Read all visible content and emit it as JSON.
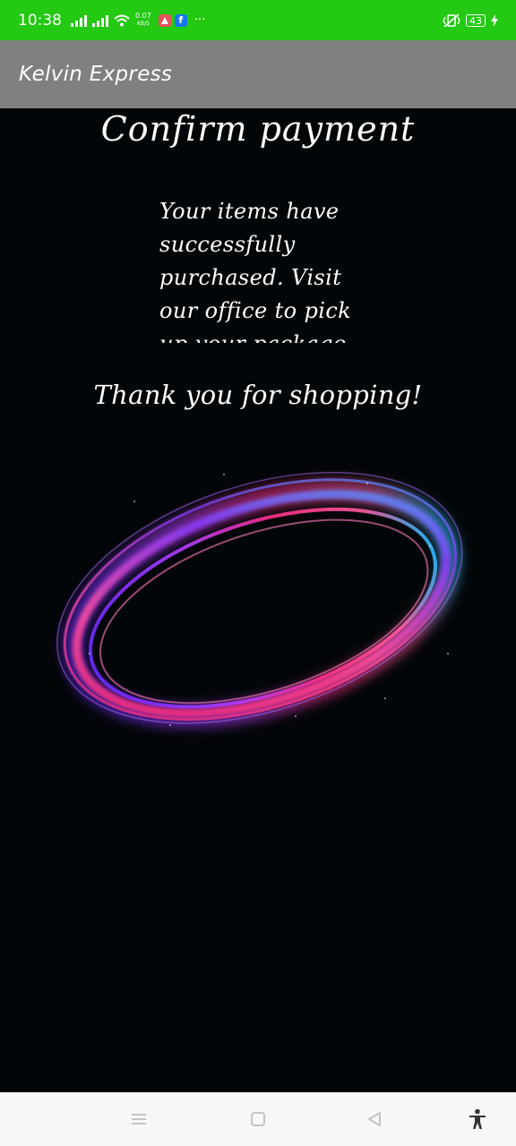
{
  "status_bar": {
    "time": "10:38",
    "net_speed_value": "0.07",
    "net_speed_unit": "KB/S",
    "more_indicator": "···",
    "battery_level": "43",
    "icons": [
      "signal-icon",
      "signal-icon",
      "wifi-icon",
      "notification-app-icon",
      "facebook-icon",
      "vibrate-icon",
      "battery-icon",
      "charging-icon"
    ]
  },
  "app_bar": {
    "title": "Kelvin Express"
  },
  "main": {
    "heading": "Confirm payment",
    "message": "Your items have successfully purchased. Visit our office to pick up your package",
    "thanks": "Thank you for shopping!",
    "image": "glowing-ring-image"
  },
  "nav_bar": {
    "icons": [
      "menu-icon",
      "home-icon",
      "back-icon",
      "accessibility-icon"
    ]
  },
  "colors": {
    "status_bar_bg": "#23c912",
    "app_bar_bg": "#808080",
    "content_bg": "#030608",
    "text": "#ffffff",
    "nav_bar_bg": "#f7f7f7"
  }
}
